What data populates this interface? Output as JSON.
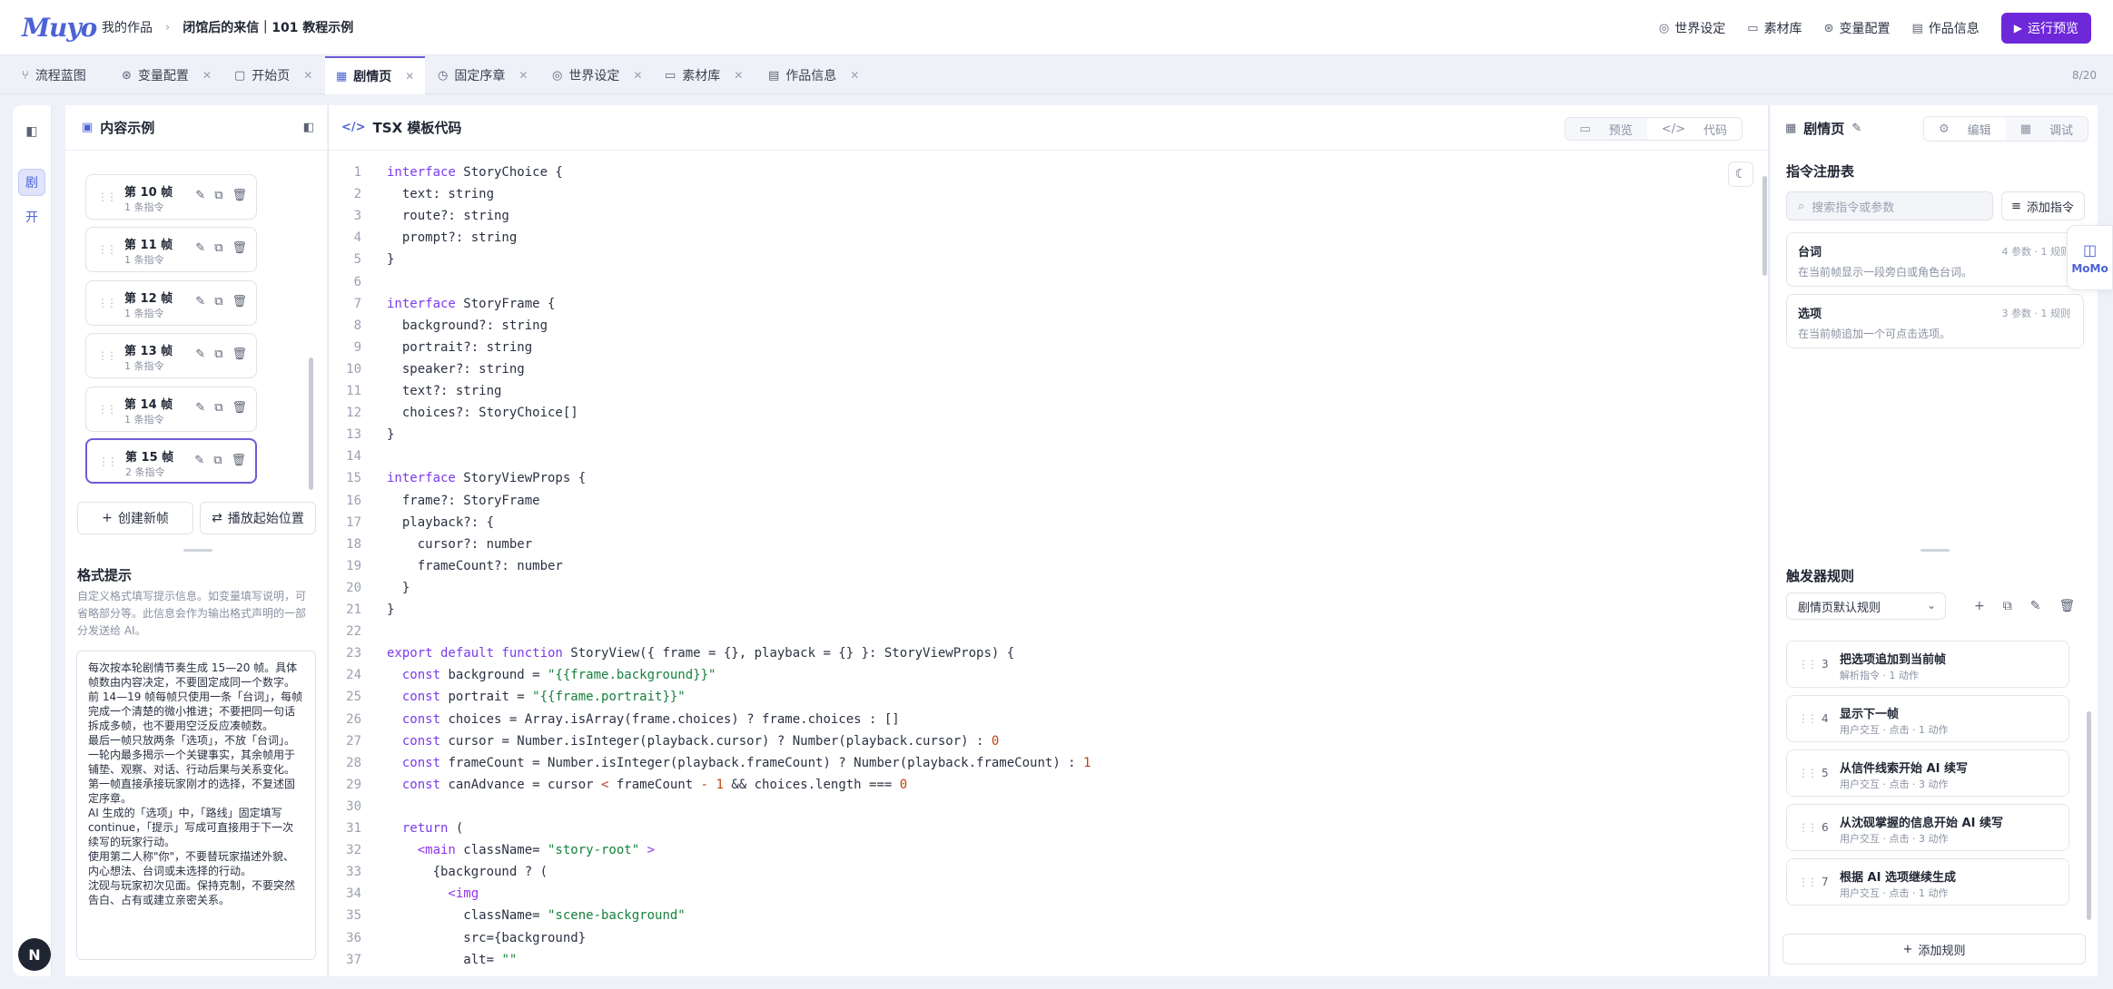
{
  "app": {
    "logo": "Muyo"
  },
  "breadcrumb": {
    "root": "我的作品",
    "separator": "›",
    "current": "闭馆后的来信｜101 教程示例"
  },
  "topnav": {
    "world": "世界设定",
    "assets": "素材库",
    "vars": "变量配置",
    "info": "作品信息",
    "run": "运行预览"
  },
  "tabs": [
    {
      "label": "流程蓝图",
      "icon": "flow-icon",
      "closable": false
    },
    {
      "label": "变量配置",
      "icon": "variable-icon",
      "closable": true
    },
    {
      "label": "开始页",
      "icon": "page-icon",
      "closable": true
    },
    {
      "label": "剧情页",
      "icon": "layout-icon",
      "closable": true,
      "active": true
    },
    {
      "label": "固定序章",
      "icon": "clock-icon",
      "closable": true
    },
    {
      "label": "世界设定",
      "icon": "globe-icon",
      "closable": true
    },
    {
      "label": "素材库",
      "icon": "archive-icon",
      "closable": true
    },
    {
      "label": "作品信息",
      "icon": "document-icon",
      "closable": true
    }
  ],
  "tab_count": "8/20",
  "rail": {
    "story": "剧",
    "start": "开"
  },
  "left": {
    "title": "内容示例",
    "frames": [
      {
        "title": "第 10 帧",
        "sub": "1 条指令"
      },
      {
        "title": "第 11 帧",
        "sub": "1 条指令"
      },
      {
        "title": "第 12 帧",
        "sub": "1 条指令"
      },
      {
        "title": "第 13 帧",
        "sub": "1 条指令"
      },
      {
        "title": "第 14 帧",
        "sub": "1 条指令"
      },
      {
        "title": "第 15 帧",
        "sub": "2 条指令"
      }
    ],
    "create": "创建新帧",
    "playback": "播放起始位置",
    "format_title": "格式提示",
    "format_desc": "自定义格式填写提示信息。如变量填写说明，可省略部分等。此信息会作为输出格式声明的一部分发送给 AI。",
    "format_text": "每次按本轮剧情节奏生成 15—20 帧。具体帧数由内容决定，不要固定成同一个数字。\n前 14—19 帧每帧只使用一条「台词」，每帧完成一个清楚的微小推进；不要把同一句话拆成多帧，也不要用空泛反应凑帧数。\n最后一帧只放两条「选项」，不放「台词」。一轮内最多揭示一个关键事实，其余帧用于铺垫、观察、对话、行动后果与关系变化。\n第一帧直接承接玩家刚才的选择，不复述固定序章。\nAI 生成的「选项」中，「路线」固定填写 continue，「提示」写成可直接用于下一次续写的玩家行动。\n使用第二人称\"你\"，不要替玩家描述外貌、内心想法、台词或未选择的行动。\n沈砚与玩家初次见面。保持克制，不要突然告白、占有或建立亲密关系。"
  },
  "editor": {
    "title": "TSX 模板代码",
    "preview": "预览",
    "code": "代码",
    "lines": [
      [
        [
          "kw",
          "interface"
        ],
        [
          "",
          "StoryChoice {"
        ]
      ],
      [
        [
          "",
          "  text: string"
        ]
      ],
      [
        [
          "",
          "  route?: string"
        ]
      ],
      [
        [
          "",
          "  prompt?: string"
        ]
      ],
      [
        [
          "",
          "}"
        ]
      ],
      [
        [
          "",
          ""
        ]
      ],
      [
        [
          "kw",
          "interface"
        ],
        [
          "",
          "StoryFrame {"
        ]
      ],
      [
        [
          "",
          "  background?: string"
        ]
      ],
      [
        [
          "",
          "  portrait?: string"
        ]
      ],
      [
        [
          "",
          "  speaker?: string"
        ]
      ],
      [
        [
          "",
          "  text?: string"
        ]
      ],
      [
        [
          "",
          "  choices?: StoryChoice[]"
        ]
      ],
      [
        [
          "",
          "}"
        ]
      ],
      [
        [
          "",
          ""
        ]
      ],
      [
        [
          "kw",
          "interface"
        ],
        [
          "",
          "StoryViewProps {"
        ]
      ],
      [
        [
          "",
          "  frame?: StoryFrame"
        ]
      ],
      [
        [
          "",
          "  playback?: {"
        ]
      ],
      [
        [
          "",
          "    cursor?: number"
        ]
      ],
      [
        [
          "",
          "    frameCount?: number"
        ]
      ],
      [
        [
          "",
          "  }"
        ]
      ],
      [
        [
          "",
          "}"
        ]
      ],
      [
        [
          "",
          ""
        ]
      ],
      [
        [
          "kw",
          "export default function"
        ],
        [
          "",
          "StoryView({ frame = {}, playback = {} }: StoryViewProps) {"
        ]
      ],
      [
        [
          "kw",
          "  const"
        ],
        [
          "",
          "background ="
        ],
        [
          "str",
          "\"{{frame.background}}\""
        ]
      ],
      [
        [
          "kw",
          "  const"
        ],
        [
          "",
          "portrait ="
        ],
        [
          "str",
          "\"{{frame.portrait}}\""
        ]
      ],
      [
        [
          "kw",
          "  const"
        ],
        [
          "",
          "choices = Array.isArray(frame.choices) ? frame.choices : []"
        ]
      ],
      [
        [
          "kw",
          "  const"
        ],
        [
          "",
          "cursor = Number.isInteger(playback.cursor) ? Number(playback.cursor) :"
        ],
        [
          "num",
          "0"
        ]
      ],
      [
        [
          "kw",
          "  const"
        ],
        [
          "",
          "frameCount = Number.isInteger(playback.frameCount) ? Number(playback.frameCount) :"
        ],
        [
          "num",
          "1"
        ]
      ],
      [
        [
          "kw",
          "  const"
        ],
        [
          "",
          "canAdvance = cursor"
        ],
        [
          "op",
          "<"
        ],
        [
          "",
          "frameCount"
        ],
        [
          "op",
          "-"
        ],
        [
          "num",
          "1"
        ],
        [
          "",
          "&& choices.length ==="
        ],
        [
          "num",
          "0"
        ]
      ],
      [
        [
          "",
          ""
        ]
      ],
      [
        [
          "kw",
          "  return"
        ],
        [
          "",
          "("
        ]
      ],
      [
        [
          "tg",
          "    <main"
        ],
        [
          "",
          "className="
        ],
        [
          "str",
          "\"story-root\""
        ],
        [
          "tg",
          ">"
        ]
      ],
      [
        [
          "",
          "      {background ? ("
        ]
      ],
      [
        [
          "tg",
          "        <img"
        ]
      ],
      [
        [
          "",
          "          className="
        ],
        [
          "str",
          "\"scene-background\""
        ]
      ],
      [
        [
          "",
          "          src={background}"
        ]
      ],
      [
        [
          "",
          "          alt="
        ],
        [
          "str",
          "\"\""
        ]
      ]
    ]
  },
  "right": {
    "title": "剧情页",
    "edit": "编辑",
    "debug": "调试",
    "registry_title": "指令注册表",
    "search_placeholder": "搜索指令或参数",
    "add_command": "添加指令",
    "commands": [
      {
        "name": "台词",
        "meta": "4 参数 · 1 规则",
        "desc": "在当前帧显示一段旁白或角色台词。"
      },
      {
        "name": "选项",
        "meta": "3 参数 · 1 规则",
        "desc": "在当前帧追加一个可点击选项。"
      }
    ],
    "trigger_title": "触发器规则",
    "rule_select": "剧情页默认规则",
    "rules": [
      {
        "no": "3",
        "title": "把选项追加到当前帧",
        "sub": "解析指令 · 1 动作"
      },
      {
        "no": "4",
        "title": "显示下一帧",
        "sub": "用户交互 · 点击 · 1 动作"
      },
      {
        "no": "5",
        "title": "从信件线索开始 AI 续写",
        "sub": "用户交互 · 点击 · 3 动作"
      },
      {
        "no": "6",
        "title": "从沈砚掌握的信息开始 AI 续写",
        "sub": "用户交互 · 点击 · 3 动作"
      },
      {
        "no": "7",
        "title": "根据 AI 选项继续生成",
        "sub": "用户交互 · 点击 · 1 动作"
      }
    ],
    "add_rule": "添加规则"
  },
  "momo": {
    "label": "MoMo"
  },
  "badge": {
    "label": "N"
  }
}
